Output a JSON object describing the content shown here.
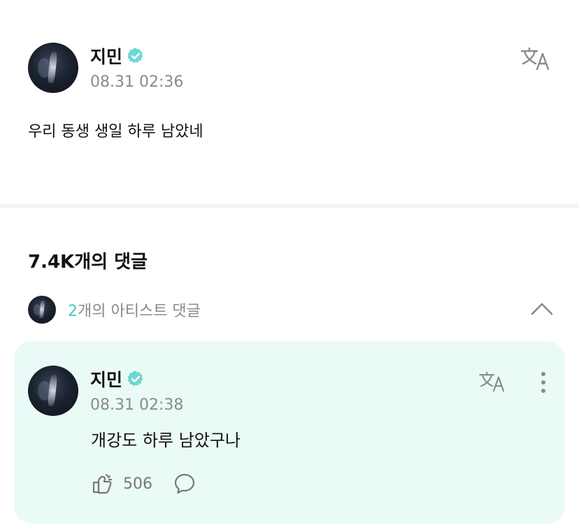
{
  "post": {
    "author": "지민",
    "timestamp": "08.31 02:36",
    "text": "우리 동생 생일 하루 남았네"
  },
  "comments": {
    "title": "7.4K개의 댓글",
    "artist_count": "2",
    "artist_label": "개의 아티스트 댓글"
  },
  "comment": {
    "author": "지민",
    "timestamp": "08.31 02:38",
    "text": "개강도 하루 남았구나",
    "likes": "506"
  },
  "icons": {
    "verified": "verified-badge-icon",
    "translate": "translate-icon",
    "chevron": "chevron-up-icon",
    "more": "more-vertical-icon",
    "like": "like-icon",
    "reply": "reply-icon"
  },
  "colors": {
    "accent": "#46c9c0",
    "verified": "#6fd6d0",
    "card_bg": "#eafaf7"
  }
}
